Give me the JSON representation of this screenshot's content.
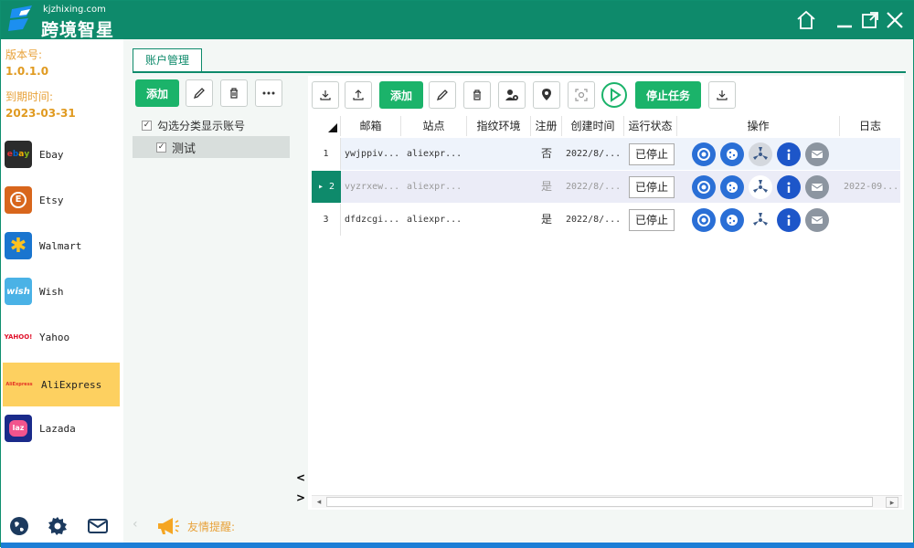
{
  "app": {
    "domain": "kjzhixing.com",
    "brand": "跨境智星"
  },
  "window_controls": [
    "home-icon",
    "minimize-icon",
    "restore-icon",
    "close-icon"
  ],
  "sidebar": {
    "version_label": "版本号:",
    "version_value": "1.0.1.0",
    "expire_label": "到期时间:",
    "expire_value": "2023-03-31",
    "platforms": [
      {
        "name": "Ebay",
        "logo_text": "ebay",
        "color": "#2b2b2b",
        "active": false
      },
      {
        "name": "Etsy",
        "logo_text": "E",
        "color": "#d8661c",
        "active": false
      },
      {
        "name": "Walmart",
        "logo_text": "✱",
        "color": "#1a75cf",
        "active": false
      },
      {
        "name": "Wish",
        "logo_text": "wish",
        "color": "#4ab2e6",
        "active": false
      },
      {
        "name": "Yahoo",
        "logo_text": "YAHOO!",
        "color": "#ffffff",
        "active": false
      },
      {
        "name": "AliExpress",
        "logo_text": "AliExpress",
        "color": "#fdd060",
        "active": true
      },
      {
        "name": "Lazada",
        "logo_text": "laz",
        "color": "#1a2a8a",
        "active": false
      }
    ],
    "bottom_icons": [
      "globe-icon",
      "gear-icon",
      "mail-icon"
    ]
  },
  "tab": {
    "label": "账户管理"
  },
  "left_pane": {
    "add_label": "添加",
    "tree_root_label": "勾选分类显示账号",
    "tree_child_label": "测试"
  },
  "toolbar": {
    "add_label": "添加",
    "stop_label": "停止任务"
  },
  "table": {
    "columns": [
      "邮箱",
      "站点",
      "指纹环境",
      "注册",
      "创建时间",
      "运行状态",
      "操作",
      "日志"
    ],
    "rows": [
      {
        "num": "1",
        "email": "ywjppiv...",
        "site": "aliexpr...",
        "fingerprint": "",
        "registered": "否",
        "created": "2022/8/...",
        "status": "已停止",
        "log": "",
        "selected": false
      },
      {
        "num": "2",
        "email": "vyzrxew...",
        "site": "aliexpr...",
        "fingerprint": "",
        "registered": "是",
        "created": "2022/8/...",
        "status": "已停止",
        "log": "2022-09...",
        "selected": true
      },
      {
        "num": "3",
        "email": "dfdzcgi...",
        "site": "aliexpr...",
        "fingerprint": "",
        "registered": "是",
        "created": "2022/8/...",
        "status": "已停止",
        "log": "",
        "selected": false
      }
    ]
  },
  "footer": {
    "notice_label": "友情提醒:"
  }
}
